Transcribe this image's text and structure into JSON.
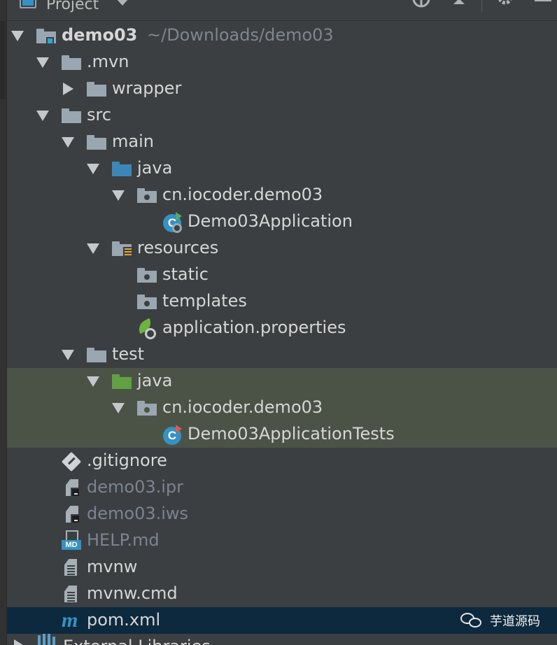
{
  "panel": {
    "title": "Project"
  },
  "tree": {
    "root": {
      "name": "demo03",
      "path": "~/Downloads/demo03"
    },
    "items": [
      {
        "label": ".mvn"
      },
      {
        "label": "wrapper"
      },
      {
        "label": "src"
      },
      {
        "label": "main"
      },
      {
        "label": "java"
      },
      {
        "label": "cn.iocoder.demo03"
      },
      {
        "label": "Demo03Application"
      },
      {
        "label": "resources"
      },
      {
        "label": "static"
      },
      {
        "label": "templates"
      },
      {
        "label": "application.properties"
      },
      {
        "label": "test"
      },
      {
        "label": "java"
      },
      {
        "label": "cn.iocoder.demo03"
      },
      {
        "label": "Demo03ApplicationTests"
      },
      {
        "label": ".gitignore"
      },
      {
        "label": "demo03.ipr"
      },
      {
        "label": "demo03.iws"
      },
      {
        "label": "HELP.md"
      },
      {
        "label": "mvnw"
      },
      {
        "label": "mvnw.cmd"
      },
      {
        "label": "pom.xml"
      }
    ],
    "external": "External Libraries"
  },
  "icons": {
    "class_badge": "C",
    "md_badge": "MD",
    "maven_badge": "m"
  },
  "watermark": {
    "text": "芋道源码"
  },
  "colors": {
    "background": "#3c3f41",
    "highlight_row": "#4b5347",
    "selected_row": "#0d293e",
    "source_folder": "#3d87b8",
    "test_folder": "#61a043",
    "class_icon": "#3592c4"
  }
}
